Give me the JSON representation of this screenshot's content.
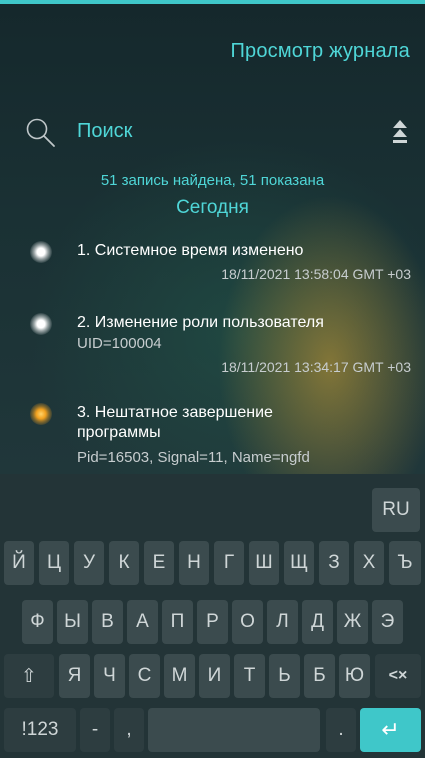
{
  "header": {
    "title": "Просмотр журнала"
  },
  "search": {
    "label": "Поиск",
    "icon": "search-icon"
  },
  "sort": {
    "icon": "sort-icon"
  },
  "summary": {
    "count_text": "51 запись найдена, 51 показана",
    "day_label": "Сегодня"
  },
  "entries": [
    {
      "title": "1. Системное время изменено",
      "detail": "",
      "time": "18/11/2021 13:58:04 GMT +03",
      "status": "white"
    },
    {
      "title": "2. Изменение роли пользователя",
      "detail": "UID=100004",
      "time": "18/11/2021 13:34:17 GMT +03",
      "status": "white"
    },
    {
      "title": "3. Нештатное завершение программы",
      "detail": "Pid=16503, Signal=11, Name=ngfd",
      "time": "",
      "status": "orange"
    }
  ],
  "keyboard": {
    "lang": "RU",
    "row1": [
      "Й",
      "Ц",
      "У",
      "К",
      "Е",
      "Н",
      "Г",
      "Ш",
      "Щ",
      "З",
      "Х",
      "Ъ"
    ],
    "row2": [
      "Ф",
      "Ы",
      "В",
      "А",
      "П",
      "Р",
      "О",
      "Л",
      "Д",
      "Ж",
      "Э"
    ],
    "row3": [
      "Я",
      "Ч",
      "С",
      "М",
      "И",
      "Т",
      "Ь",
      "Б",
      "Ю"
    ],
    "shift_glyph": "⇧",
    "backspace_glyph": "<×",
    "symbols": "!123",
    "dash": "-",
    "comma": ",",
    "period": ".",
    "enter_glyph": "↵"
  },
  "colors": {
    "accent": "#4fd6d7",
    "top_bar": "#3fc7c9",
    "warning": "#f2a11f",
    "keyboard_bg": "#233437",
    "key_bg": "#3b4b4e"
  }
}
